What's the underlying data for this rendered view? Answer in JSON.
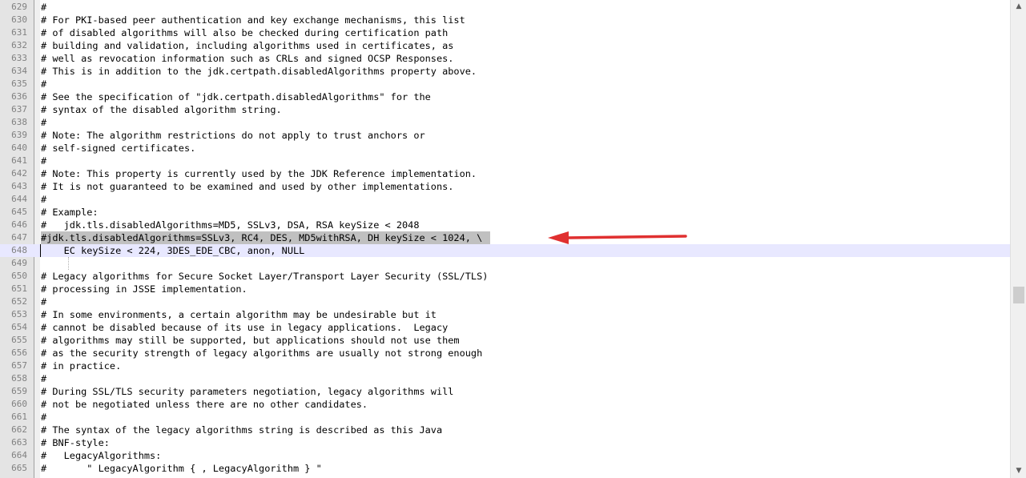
{
  "editor": {
    "lines": [
      {
        "n": "629",
        "text": "#"
      },
      {
        "n": "630",
        "text": "# For PKI-based peer authentication and key exchange mechanisms, this list"
      },
      {
        "n": "631",
        "text": "# of disabled algorithms will also be checked during certification path"
      },
      {
        "n": "632",
        "text": "# building and validation, including algorithms used in certificates, as"
      },
      {
        "n": "633",
        "text": "# well as revocation information such as CRLs and signed OCSP Responses."
      },
      {
        "n": "634",
        "text": "# This is in addition to the jdk.certpath.disabledAlgorithms property above."
      },
      {
        "n": "635",
        "text": "#"
      },
      {
        "n": "636",
        "text": "# See the specification of \"jdk.certpath.disabledAlgorithms\" for the"
      },
      {
        "n": "637",
        "text": "# syntax of the disabled algorithm string."
      },
      {
        "n": "638",
        "text": "#"
      },
      {
        "n": "639",
        "text": "# Note: The algorithm restrictions do not apply to trust anchors or"
      },
      {
        "n": "640",
        "text": "# self-signed certificates."
      },
      {
        "n": "641",
        "text": "#"
      },
      {
        "n": "642",
        "text": "# Note: This property is currently used by the JDK Reference implementation."
      },
      {
        "n": "643",
        "text": "# It is not guaranteed to be examined and used by other implementations."
      },
      {
        "n": "644",
        "text": "#"
      },
      {
        "n": "645",
        "text": "# Example:"
      },
      {
        "n": "646",
        "text": "#   jdk.tls.disabledAlgorithms=MD5, SSLv3, DSA, RSA keySize < 2048"
      },
      {
        "n": "647",
        "text": "#jdk.tls.disabledAlgorithms=SSLv3, RC4, DES, MD5withRSA, DH keySize < 1024, \\"
      },
      {
        "n": "648",
        "text": "    EC keySize < 224, 3DES_EDE_CBC, anon, NULL"
      },
      {
        "n": "649",
        "text": ""
      },
      {
        "n": "650",
        "text": "# Legacy algorithms for Secure Socket Layer/Transport Layer Security (SSL/TLS)"
      },
      {
        "n": "651",
        "text": "# processing in JSSE implementation."
      },
      {
        "n": "652",
        "text": "#"
      },
      {
        "n": "653",
        "text": "# In some environments, a certain algorithm may be undesirable but it"
      },
      {
        "n": "654",
        "text": "# cannot be disabled because of its use in legacy applications.  Legacy"
      },
      {
        "n": "655",
        "text": "# algorithms may still be supported, but applications should not use them"
      },
      {
        "n": "656",
        "text": "# as the security strength of legacy algorithms are usually not strong enough"
      },
      {
        "n": "657",
        "text": "# in practice."
      },
      {
        "n": "658",
        "text": "#"
      },
      {
        "n": "659",
        "text": "# During SSL/TLS security parameters negotiation, legacy algorithms will"
      },
      {
        "n": "660",
        "text": "# not be negotiated unless there are no other candidates."
      },
      {
        "n": "661",
        "text": "#"
      },
      {
        "n": "662",
        "text": "# The syntax of the legacy algorithms string is described as this Java"
      },
      {
        "n": "663",
        "text": "# BNF-style:"
      },
      {
        "n": "664",
        "text": "#   LegacyAlgorithms:"
      },
      {
        "n": "665",
        "text": "#       \" LegacyAlgorithm { , LegacyAlgorithm } \""
      }
    ],
    "selected_line": "647",
    "current_line": "648"
  },
  "colors": {
    "selection": "#c0c0c0",
    "current_line": "#e8e8ff",
    "annotation_arrow": "#e03030",
    "gutter": "#e4e4e4"
  },
  "scrollbar": {
    "up_icon": "triangle-up-icon",
    "down_icon": "triangle-down-icon"
  }
}
